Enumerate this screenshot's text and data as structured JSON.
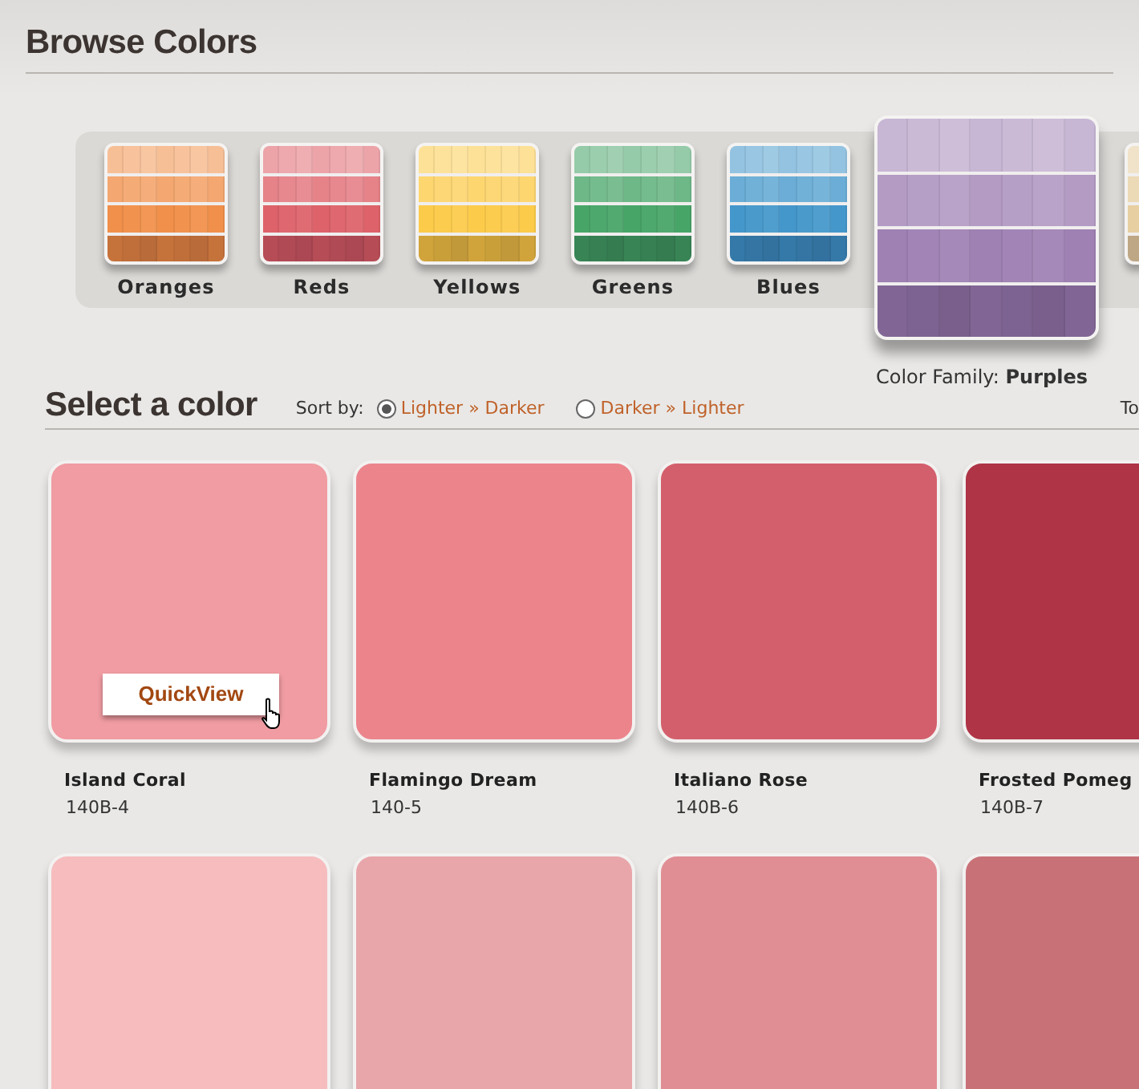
{
  "browse": {
    "title": "Browse Colors",
    "families": [
      {
        "label": "Oranges",
        "color": "#f08a40",
        "selected": false
      },
      {
        "label": "Reds",
        "color": "#dc5a62",
        "selected": false
      },
      {
        "label": "Yellows",
        "color": "#fcc840",
        "selected": false
      },
      {
        "label": "Greens",
        "color": "#3ea060",
        "selected": false
      },
      {
        "label": "Blues",
        "color": "#3a92c8",
        "selected": false
      },
      {
        "label": "Purples",
        "color": "#9a7ab0",
        "selected": true
      },
      {
        "color": "#e6cc9c",
        "selected": false
      }
    ],
    "caption_prefix": "Color Family:"
  },
  "select": {
    "title": "Select a color",
    "sort_label": "Sort by:",
    "sort_options": [
      {
        "label": "Lighter » Darker",
        "selected": true
      },
      {
        "label": "Darker » Lighter",
        "selected": false
      }
    ],
    "column_3": "To",
    "swatches": [
      {
        "name": "Island Coral",
        "code": "140B-4",
        "color": "#f09ca2",
        "quickview": "QuickView"
      },
      {
        "name": "Flamingo Dream",
        "code": "140-5",
        "color": "#ec848c"
      },
      {
        "name": "Italiano Rose",
        "code": "140B-6",
        "color": "#d45f6c"
      },
      {
        "name": "Frosted Pomeg",
        "code": "140B-7",
        "color": "#ae3446"
      },
      {
        "color": "#f6bcbe"
      },
      {
        "color": "#e8a6aa"
      },
      {
        "color": "#e08e94"
      },
      {
        "color": "#c87278"
      }
    ]
  }
}
